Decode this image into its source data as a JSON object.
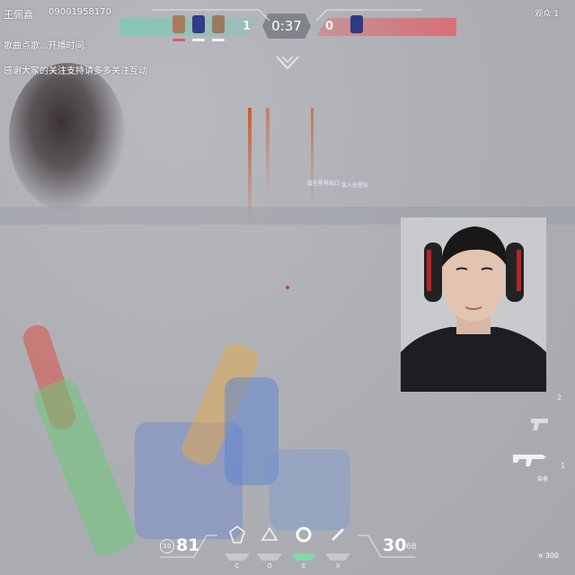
{
  "hud_top": {
    "ally_score": "1",
    "enemy_score": "0",
    "round_timer": "0:37",
    "colors": {
      "ally": "#60d2b2",
      "enemy": "#e85a5f"
    }
  },
  "stream_overlay": {
    "title": "王佩嘉",
    "room_id": "09001958170",
    "line_1": "歌曲点歌...开播时间...",
    "line_2": "感谢大家的关注支持请多多关注互动",
    "viewers_label": "观众 1"
  },
  "callouts": {
    "left": "敌在星界出口",
    "right": "敌人在星际"
  },
  "hud_bottom": {
    "shield_value": "10",
    "health": "81",
    "ability_keys": [
      "C",
      "Q",
      "E",
      "X"
    ],
    "ammo_in_mag": "30",
    "ammo_reserve": "68",
    "credits": "¤ 300"
  },
  "weapons_panel": {
    "slots": [
      "2",
      "1"
    ],
    "secondary_label": "装备"
  }
}
